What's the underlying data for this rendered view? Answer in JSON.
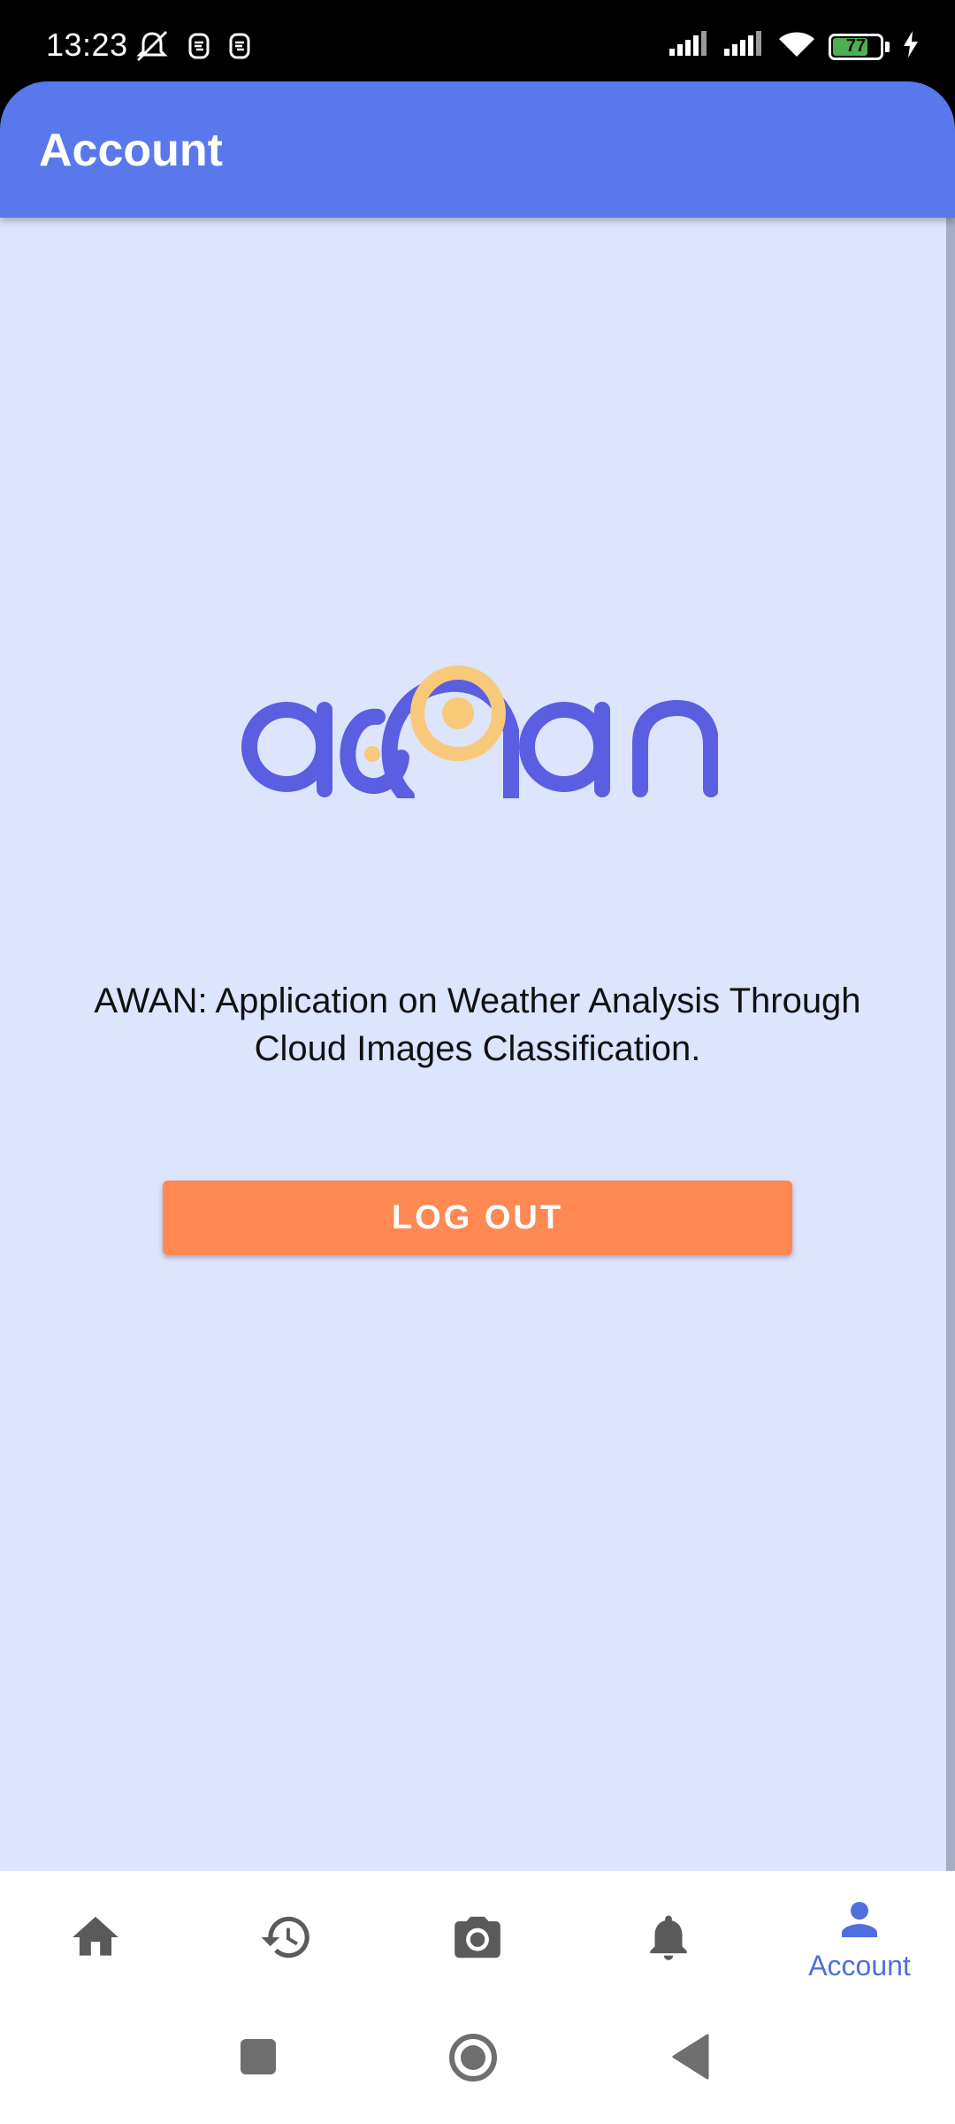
{
  "status_bar": {
    "time": "13:23",
    "battery_level": "77",
    "battery_fraction": 0.77,
    "icons": [
      "mute-icon",
      "notification-icon",
      "notification-icon",
      "signal-icon",
      "signal-icon",
      "wifi-icon",
      "battery-icon",
      "charging-icon"
    ]
  },
  "app_bar": {
    "title": "Account"
  },
  "logo": {
    "text": "awan",
    "colors": {
      "primary": "#5a5ee0",
      "accent": "#f9c97a"
    }
  },
  "content": {
    "description": "AWAN: Application on Weather Analysis Through Cloud Images Classification.",
    "logout_label": "LOG OUT"
  },
  "bottom_nav": {
    "items": [
      {
        "icon": "home-icon",
        "label": ""
      },
      {
        "icon": "history-icon",
        "label": ""
      },
      {
        "icon": "camera-icon",
        "label": ""
      },
      {
        "icon": "bell-icon",
        "label": ""
      },
      {
        "icon": "person-icon",
        "label": "Account",
        "active": true
      }
    ]
  },
  "colors": {
    "app_bar": "#5878ec",
    "background": "#dde4fd",
    "logout_button": "#ff8853",
    "active_nav": "#4f6fde"
  }
}
